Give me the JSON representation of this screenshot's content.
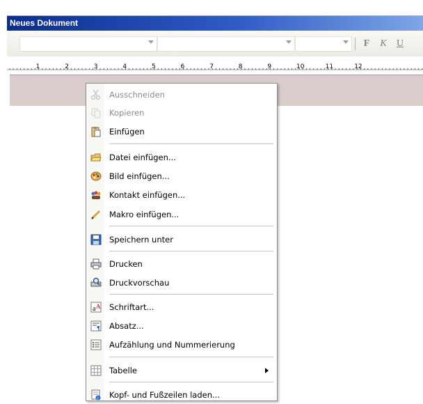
{
  "window": {
    "title": "Neues Dokument"
  },
  "toolbar": {
    "font_name": "",
    "font_style": "",
    "font_size": "",
    "bold_label": "F",
    "italic_label": "K",
    "underline_label": "U"
  },
  "ruler": {
    "numbers": [
      "1",
      "2",
      "3",
      "4",
      "5",
      "6",
      "7",
      "8",
      "9",
      "10",
      "11",
      "12"
    ]
  },
  "context_menu": {
    "items": [
      {
        "label": "Ausschneiden",
        "icon": "scissors-icon",
        "enabled": false
      },
      {
        "label": "Kopieren",
        "icon": "copy-icon",
        "enabled": false
      },
      {
        "label": "Einfügen",
        "icon": "paste-icon",
        "enabled": true
      },
      {
        "label": "Datei einfügen...",
        "icon": "open-file-icon",
        "enabled": true
      },
      {
        "label": "Bild einfügen...",
        "icon": "palette-icon",
        "enabled": true
      },
      {
        "label": "Kontakt einfügen...",
        "icon": "contacts-icon",
        "enabled": true
      },
      {
        "label": "Makro einfügen...",
        "icon": "pencil-icon",
        "enabled": true
      },
      {
        "label": "Speichern unter",
        "icon": "save-icon",
        "enabled": true
      },
      {
        "label": "Drucken",
        "icon": "printer-icon",
        "enabled": true
      },
      {
        "label": "Druckvorschau",
        "icon": "print-preview-icon",
        "enabled": true
      },
      {
        "label": "Schriftart...",
        "icon": "font-icon",
        "enabled": true
      },
      {
        "label": "Absatz...",
        "icon": "paragraph-icon",
        "enabled": true
      },
      {
        "label": "Aufzählung und Nummerierung",
        "icon": "bullet-list-icon",
        "enabled": true
      },
      {
        "label": "Tabelle",
        "icon": "table-icon",
        "enabled": true,
        "submenu": true
      },
      {
        "label": "Kopf- und Fußzeilen laden...",
        "icon": "header-footer-icon",
        "enabled": true
      }
    ]
  },
  "colors": {
    "title_bar_start": "#0b2e8c",
    "title_bar_end": "#7fa6e6",
    "header_band": "#d9cccb"
  }
}
